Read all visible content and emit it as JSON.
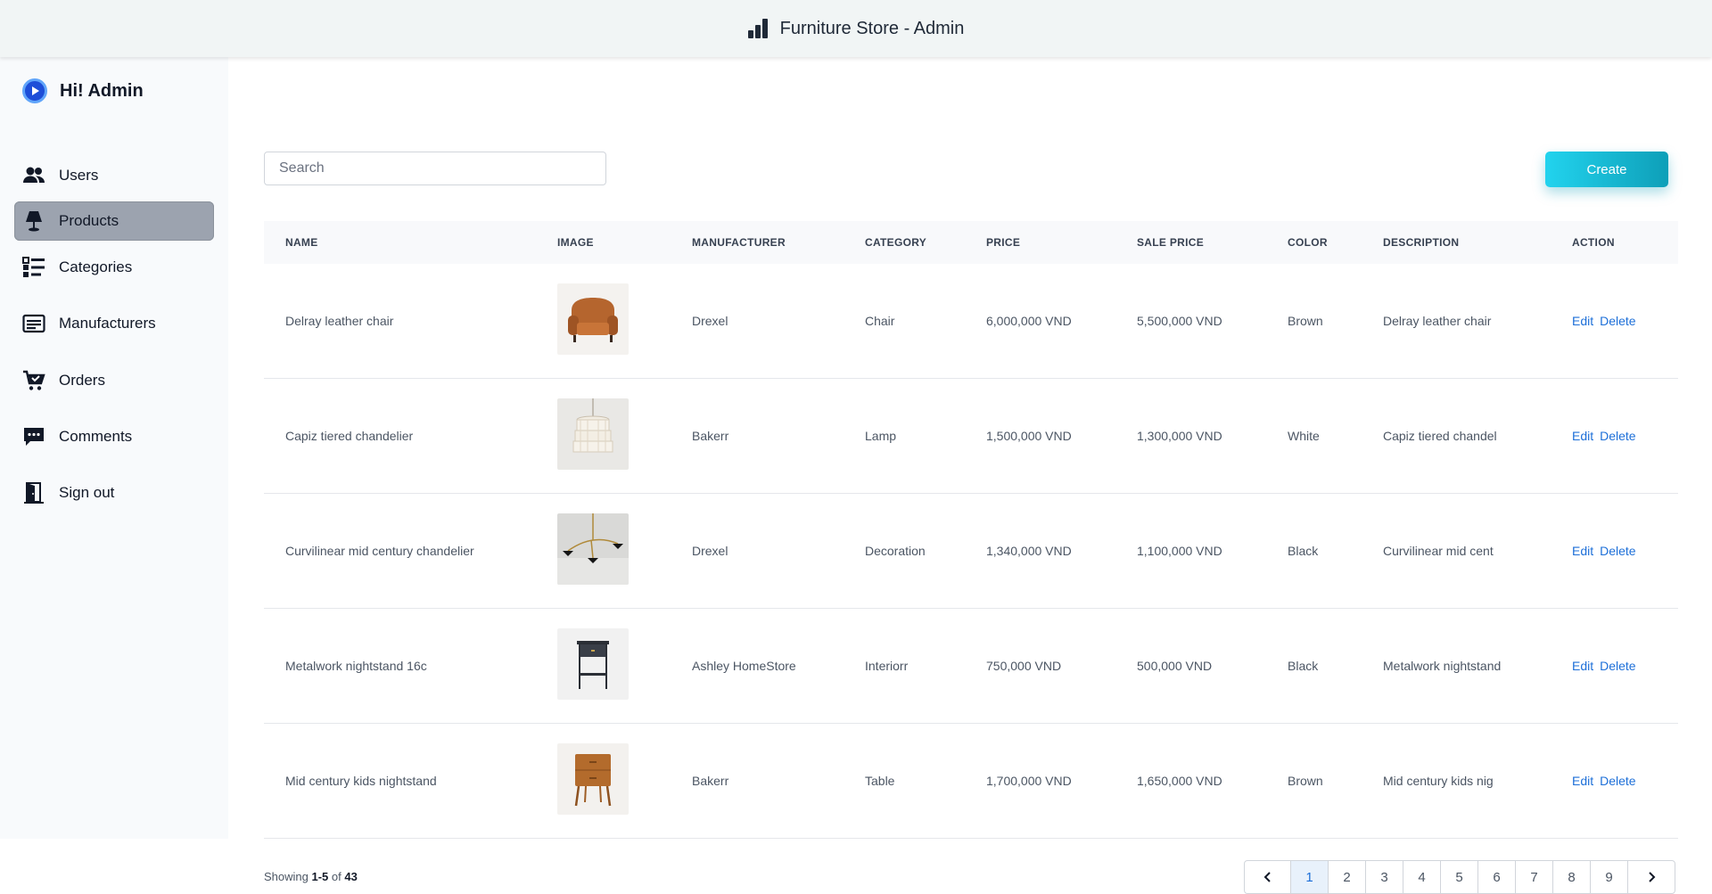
{
  "header": {
    "title": "Furniture Store - Admin",
    "icon": "bar-chart-icon"
  },
  "sidebar": {
    "greeting": "Hi! Admin",
    "items": [
      {
        "label": "Users",
        "icon": "users-icon",
        "active": false
      },
      {
        "label": "Products",
        "icon": "lamp-icon",
        "active": true
      },
      {
        "label": "Categories",
        "icon": "checklist-icon",
        "active": false
      },
      {
        "label": "Manufacturers",
        "icon": "card-icon",
        "active": false
      },
      {
        "label": "Orders",
        "icon": "cart-icon",
        "active": false
      },
      {
        "label": "Comments",
        "icon": "comment-icon",
        "active": false
      },
      {
        "label": "Sign out",
        "icon": "door-icon",
        "active": false
      }
    ]
  },
  "toolbar": {
    "search_placeholder": "Search",
    "create_label": "Create",
    "accent_color": "#17b8d4"
  },
  "table": {
    "columns": [
      "NAME",
      "IMAGE",
      "MANUFACTURER",
      "CATEGORY",
      "PRICE",
      "SALE PRICE",
      "COLOR",
      "DESCRIPTION",
      "ACTION"
    ],
    "rows": [
      {
        "name": "Delray leather chair",
        "image": "brown-leather-chair",
        "manufacturer": "Drexel",
        "category": "Chair",
        "price": "6,000,000 VND",
        "sale_price": "5,500,000 VND",
        "color": "Brown",
        "description": "Delray leather chair",
        "edit": "Edit",
        "delete": "Delete"
      },
      {
        "name": "Capiz tiered chandelier",
        "image": "capiz-chandelier",
        "manufacturer": "Bakerr",
        "category": "Lamp",
        "price": "1,500,000 VND",
        "sale_price": "1,300,000 VND",
        "color": "White",
        "description": "Capiz tiered chandel",
        "edit": "Edit",
        "delete": "Delete"
      },
      {
        "name": "Curvilinear mid century chandelier",
        "image": "curvilinear-chandelier",
        "manufacturer": "Drexel",
        "category": "Decoration",
        "price": "1,340,000 VND",
        "sale_price": "1,100,000 VND",
        "color": "Black",
        "description": "Curvilinear mid cent",
        "edit": "Edit",
        "delete": "Delete"
      },
      {
        "name": "Metalwork nightstand 16c",
        "image": "metal-nightstand",
        "manufacturer": "Ashley HomeStore",
        "category": "Interiorr",
        "price": "750,000 VND",
        "sale_price": "500,000 VND",
        "color": "Black",
        "description": "Metalwork nightstand",
        "edit": "Edit",
        "delete": "Delete"
      },
      {
        "name": "Mid century kids nightstand",
        "image": "wood-nightstand",
        "manufacturer": "Bakerr",
        "category": "Table",
        "price": "1,700,000 VND",
        "sale_price": "1,650,000 VND",
        "color": "Brown",
        "description": "Mid century kids nig",
        "edit": "Edit",
        "delete": "Delete"
      }
    ]
  },
  "footer": {
    "showing_prefix": "Showing",
    "range": "1-5",
    "of_label": "of",
    "total": "43",
    "pages": [
      "1",
      "2",
      "3",
      "4",
      "5",
      "6",
      "7",
      "8",
      "9"
    ],
    "current_page": "1",
    "prev_icon": "chevron-left-icon",
    "next_icon": "chevron-right-icon"
  }
}
